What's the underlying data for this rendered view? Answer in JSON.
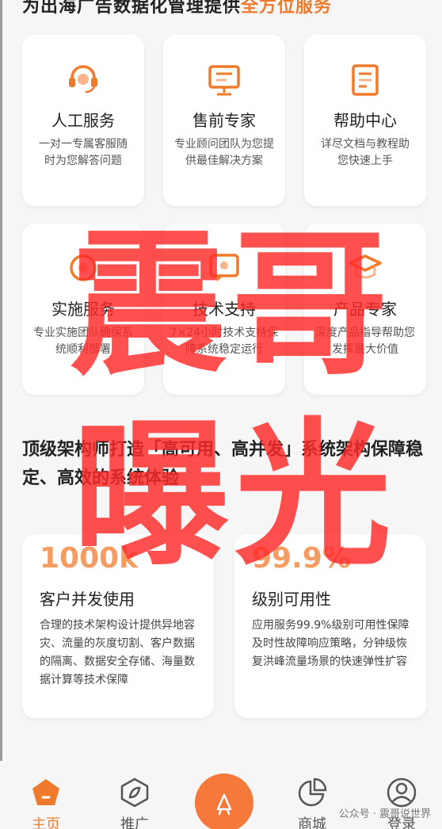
{
  "headline": {
    "text": "为出海广告数据化管理提供",
    "accent": "全方位服务"
  },
  "services": [
    {
      "title": "人工服务",
      "desc": "一对一专属客服随时为您解答问题",
      "icon": "headset-icon"
    },
    {
      "title": "售前专家",
      "desc": "专业顾问团队为您提供最佳解决方案",
      "icon": "presentation-board-icon"
    },
    {
      "title": "帮助中心",
      "desc": "详尽文档与教程助您快速上手",
      "icon": "document-icon"
    },
    {
      "title": "实施服务",
      "desc": "专业实施团队确保系统顺利部署",
      "icon": "support-icon"
    },
    {
      "title": "技术支持",
      "desc": "7×24小时技术支持保障系统稳定运行",
      "icon": "chat-support-icon"
    },
    {
      "title": "产品专家",
      "desc": "深度产品指导帮助您发挥最大价值",
      "icon": "graduation-cap-icon"
    }
  ],
  "section2": {
    "title": "顶级架构师打造「高可用、高并发」系统架构保障稳定、高效的系统体验"
  },
  "stats": [
    {
      "number": "1000k",
      "title": "客户并发使用",
      "desc": "合理的技术架构设计提供异地容灾、流量的灰度切割、客户数据的隔离、数据安全存储、海量数据计算等技术保障"
    },
    {
      "number": "99.9%",
      "title": "级别可用性",
      "desc": "应用服务99.9%级别可用性保障及时性故障响应策略，分钟级恢复洪峰流量场景的快速弹性扩容"
    }
  ],
  "watermark": {
    "line1": "震哥",
    "line2": "曝光"
  },
  "tabbar": {
    "items": [
      {
        "label": "主页",
        "icon": "home-icon",
        "active": true
      },
      {
        "label": "推广",
        "icon": "compass-icon",
        "active": false
      },
      {
        "label": "",
        "icon": "rocket-icon",
        "active": false
      },
      {
        "label": "商城",
        "icon": "pie-chart-icon",
        "active": false
      },
      {
        "label": "登录",
        "icon": "user-icon",
        "active": false
      }
    ]
  },
  "footer": {
    "source": "公众号 · 震哥说世界"
  },
  "colors": {
    "accent": "#f07a2c",
    "watermark": "#ff2a2a",
    "background": "#f6f6f6"
  }
}
